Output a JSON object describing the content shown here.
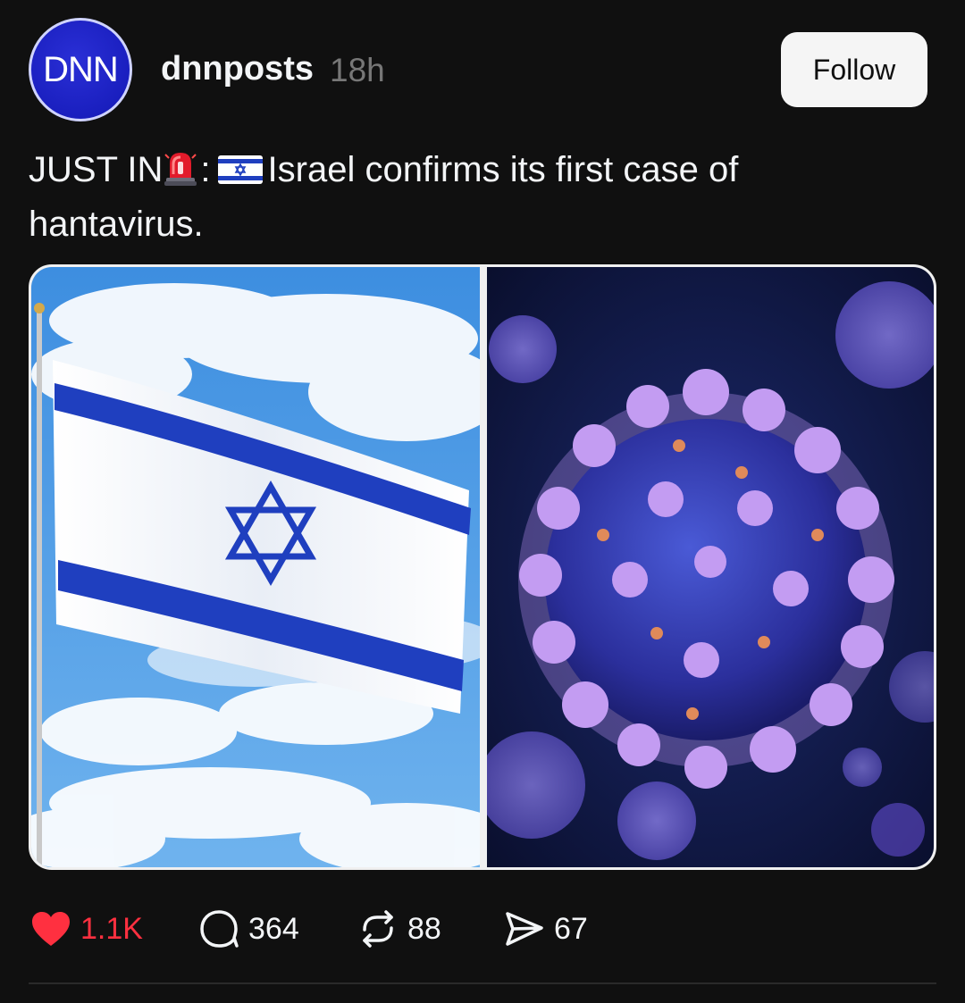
{
  "post": {
    "author_avatar_text": "DNN",
    "username": "dnnposts",
    "time": "18h",
    "follow_label": "Follow",
    "text_prefix": "JUST IN",
    "text_sep": ":",
    "text_line1": "Israel confirms its first case of",
    "text_line2": "hantavirus.",
    "media": [
      {
        "subject": "israel-flag"
      },
      {
        "subject": "virus-particle"
      }
    ]
  },
  "actions": {
    "likes": "1.1K",
    "comments": "364",
    "reposts": "88",
    "shares": "67"
  },
  "colors": {
    "like": "#ff3040",
    "background": "#101010",
    "avatar": "#1a1fbf",
    "flag_blue": "#1f3fbf"
  },
  "icons": [
    "heart-icon",
    "comment-icon",
    "repost-icon",
    "share-icon",
    "siren-emoji",
    "israel-flag-emoji"
  ]
}
